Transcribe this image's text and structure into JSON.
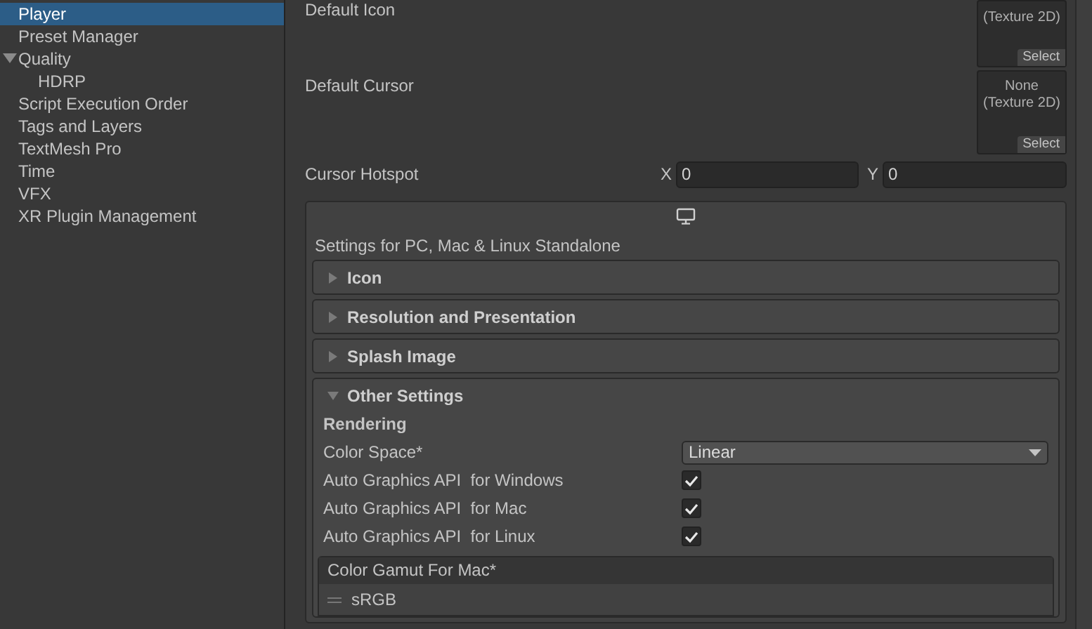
{
  "sidebar": {
    "items": [
      {
        "label": "Player",
        "selected": true
      },
      {
        "label": "Preset Manager",
        "selected": false
      },
      {
        "label": "Quality",
        "selected": false,
        "expanded": true,
        "children": [
          {
            "label": "HDRP",
            "selected": false
          }
        ]
      },
      {
        "label": "Script Execution Order",
        "selected": false
      },
      {
        "label": "Tags and Layers",
        "selected": false
      },
      {
        "label": "TextMesh Pro",
        "selected": false
      },
      {
        "label": "Time",
        "selected": false
      },
      {
        "label": "VFX",
        "selected": false
      },
      {
        "label": "XR Plugin Management",
        "selected": false
      }
    ]
  },
  "texture_fields": [
    {
      "label": "Default Icon",
      "value": "(Texture 2D)",
      "button": "Select"
    },
    {
      "label": "Default Cursor",
      "value": "None\n(Texture 2D)",
      "button": "Select"
    }
  ],
  "cursor_hotspot": {
    "label": "Cursor Hotspot",
    "x_label": "X",
    "x_value": "0",
    "y_label": "Y",
    "y_value": "0"
  },
  "platform_panel": {
    "title": "Settings for PC, Mac & Linux Standalone",
    "sections": [
      {
        "label": "Icon",
        "expanded": false
      },
      {
        "label": "Resolution and Presentation",
        "expanded": false
      },
      {
        "label": "Splash Image",
        "expanded": false
      },
      {
        "label": "Other Settings",
        "expanded": true
      }
    ]
  },
  "other_settings": {
    "heading": "Rendering",
    "rows": [
      {
        "kind": "dropdown",
        "label": "Color Space*",
        "value": "Linear"
      },
      {
        "kind": "checkbox",
        "label": "Auto Graphics API  for Windows",
        "checked": true
      },
      {
        "kind": "checkbox",
        "label": "Auto Graphics API  for Mac",
        "checked": true
      },
      {
        "kind": "checkbox",
        "label": "Auto Graphics API  for Linux",
        "checked": true
      }
    ],
    "gamut_list": {
      "title": "Color Gamut For Mac*",
      "items": [
        "sRGB"
      ]
    }
  }
}
